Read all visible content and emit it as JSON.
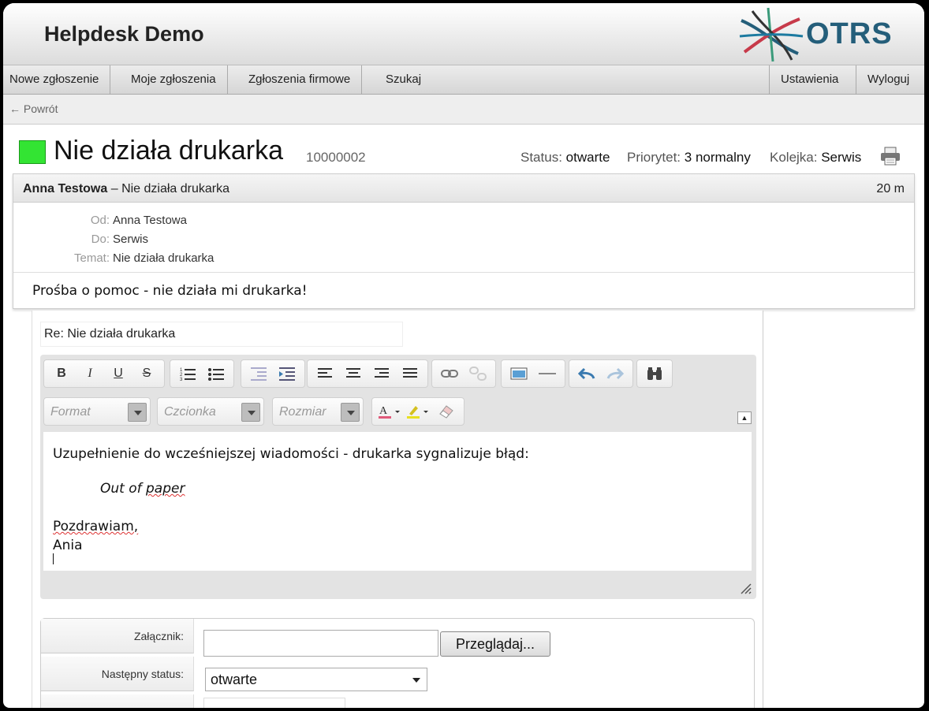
{
  "header": {
    "title": "Helpdesk Demo",
    "logo_text": "OTRS"
  },
  "nav": {
    "items": [
      "Nowe zgłoszenie",
      "Moje zgłoszenia",
      "Zgłoszenia firmowe",
      "Szukaj"
    ],
    "right": [
      "Ustawienia",
      "Wyloguj"
    ]
  },
  "back": {
    "label": "← Powrót"
  },
  "ticket": {
    "title": "Nie działa drukarka",
    "number": "10000002",
    "status_label": "Status:",
    "status_value": "otwarte",
    "priority_label": "Priorytet:",
    "priority_value": "3 normalny",
    "queue_label": "Kolejka:",
    "queue_value": "Serwis",
    "status_color": "#33e433"
  },
  "article": {
    "sender": "Anna Testowa",
    "subject_sep": " – Nie działa drukarka",
    "age": "20 m",
    "fields": [
      {
        "label": "Od:",
        "value": "Anna Testowa"
      },
      {
        "label": "Do:",
        "value": "Serwis"
      },
      {
        "label": "Temat:",
        "value": "Nie działa drukarka"
      }
    ],
    "body": "Prośba o pomoc - nie działa mi drukarka!"
  },
  "reply": {
    "subject": "Re: Nie działa drukarka",
    "toolbar": {
      "format": "Format",
      "font": "Czcionka",
      "size": "Rozmiar"
    },
    "content": {
      "line1": "Uzupełnienie do wcześniejszej wiadomości - drukarka sygnalizuje błąd:",
      "line2a": "Out of ",
      "line2b": "paper",
      "line3": "Pozdrawiam,",
      "line4": "Ania"
    }
  },
  "form": {
    "attachment_label": "Załącznik:",
    "browse_label": "Przeglądaj...",
    "next_status_label": "Następny status:",
    "next_status_value": "otwarte"
  }
}
